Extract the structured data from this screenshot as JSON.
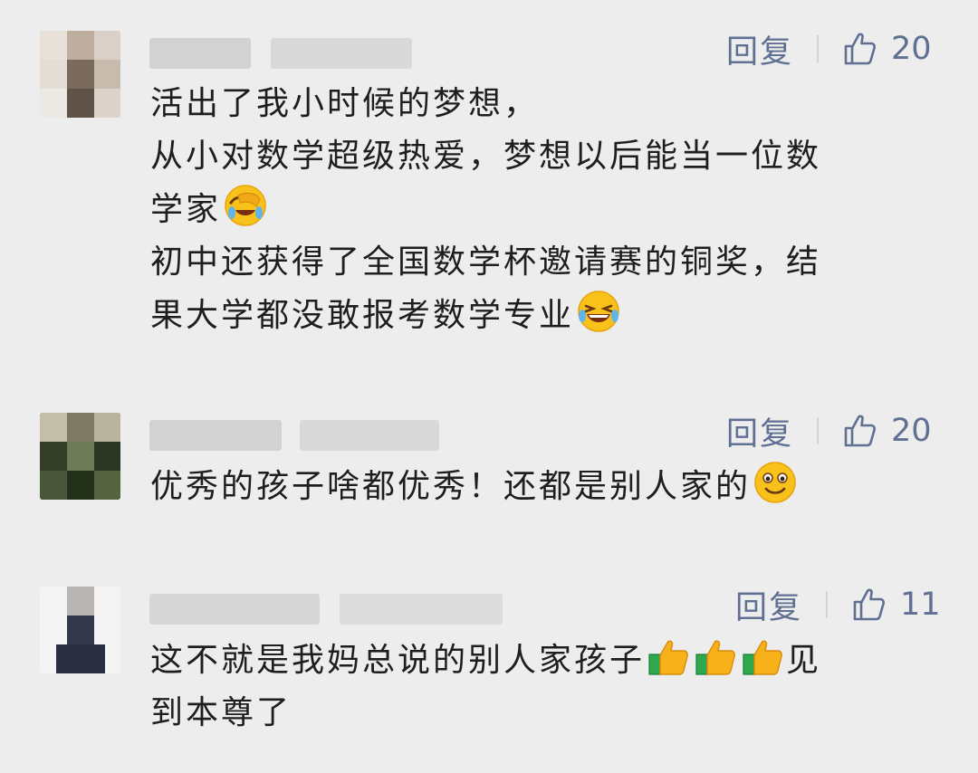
{
  "comments": [
    {
      "reply_label": "回复",
      "like_count": "20",
      "lines": [
        "活出了我小时候的梦想，",
        "从小对数学超级热爱，梦想以后能当一位数",
        "学家",
        "初中还获得了全国数学杯邀请赛的铜奖，结",
        "果大学都没敢报考数学专业"
      ],
      "emojis": [
        "facepalm-laugh",
        "laugh-tears"
      ]
    },
    {
      "reply_label": "回复",
      "like_count": "20",
      "lines": [
        "优秀的孩子啥都优秀！还都是别人家的"
      ],
      "emojis": [
        "smile"
      ]
    },
    {
      "reply_label": "回复",
      "like_count": "11",
      "lines": [
        "这不就是我妈总说的别人家孩子",
        "见",
        "到本尊了"
      ],
      "emojis": [
        "thumbs-up",
        "thumbs-up",
        "thumbs-up"
      ]
    }
  ],
  "colors": {
    "background": "#ededed",
    "action_text": "#5f7093",
    "body_text": "#1e1e1e"
  }
}
